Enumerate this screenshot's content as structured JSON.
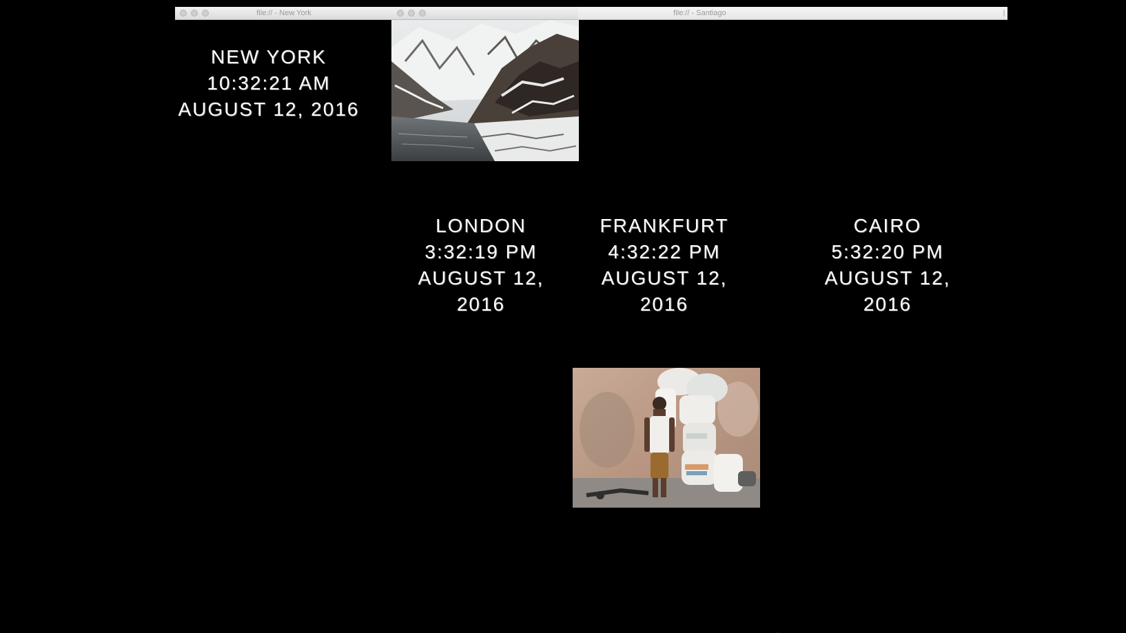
{
  "windows": [
    {
      "title": "file:// - New York"
    },
    {
      "title": "file:// - Santiago"
    }
  ],
  "clocks": {
    "new_york": {
      "city": "NEW YORK",
      "time": "10:32:21 AM",
      "date": "AUGUST 12, 2016"
    },
    "london": {
      "city": "LONDON",
      "time": "3:32:19 PM",
      "date": "AUGUST 12, 2016"
    },
    "frankfurt": {
      "city": "FRANKFURT",
      "time": "4:32:22 PM",
      "date": "AUGUST 12, 2016"
    },
    "cairo": {
      "city": "CAIRO",
      "time": "5:32:20 PM",
      "date": "AUGUST 12, 2016"
    }
  },
  "photos": {
    "mountain": {
      "subject": "snowy-mountain-lake-photo"
    },
    "worker": {
      "subject": "worker-with-flour-sacks-photo"
    }
  },
  "colors": {
    "background": "#000000",
    "text": "#ffffff",
    "titlebar": "#e6e6e6"
  }
}
